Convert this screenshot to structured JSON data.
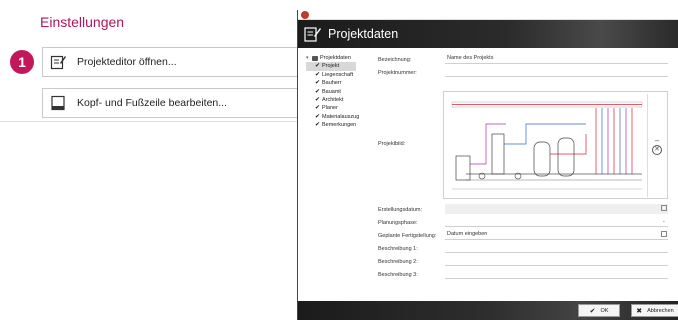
{
  "settings": {
    "title": "Einstellungen",
    "step_number": "1",
    "buttons": [
      {
        "label": "Projekteditor öffnen...",
        "icon": "edit-document-icon"
      },
      {
        "label": "Kopf- und Fußzeile bearbeiten...",
        "icon": "page-header-icon"
      }
    ]
  },
  "dialog": {
    "title": "Projektdaten",
    "tree": {
      "root": "Projektdaten",
      "items": [
        "Projekt",
        "Liegenschaft",
        "Bauherr",
        "Bauamt",
        "Architekt",
        "Planer",
        "Materialauszug",
        "Bemerkungen"
      ],
      "selected": "Projekt"
    },
    "form": {
      "bezeichnung_label": "Bezeichnung:",
      "bezeichnung_value": "Name des Projekts",
      "projektnummer_label": "Projektnummer:",
      "projektbild_label": "Projektbild:",
      "erstellungsdatum_label": "Erstellungsdatum:",
      "planungsphase_label": "Planungsphase:",
      "fertigstellung_label": "Geplante Fertigstellung:",
      "fertigstellung_value": "Datum eingeben",
      "beschreibung1_label": "Beschreibung 1:",
      "beschreibung2_label": "Beschreibung 2:",
      "beschreibung3_label": "Beschreibung 3:"
    },
    "footer": {
      "ok_label": "OK",
      "cancel_label": "Abbrechen"
    }
  },
  "colors": {
    "accent": "#c2185b",
    "title_color": "#b0135f",
    "header_dark": "#1b1b1b"
  }
}
